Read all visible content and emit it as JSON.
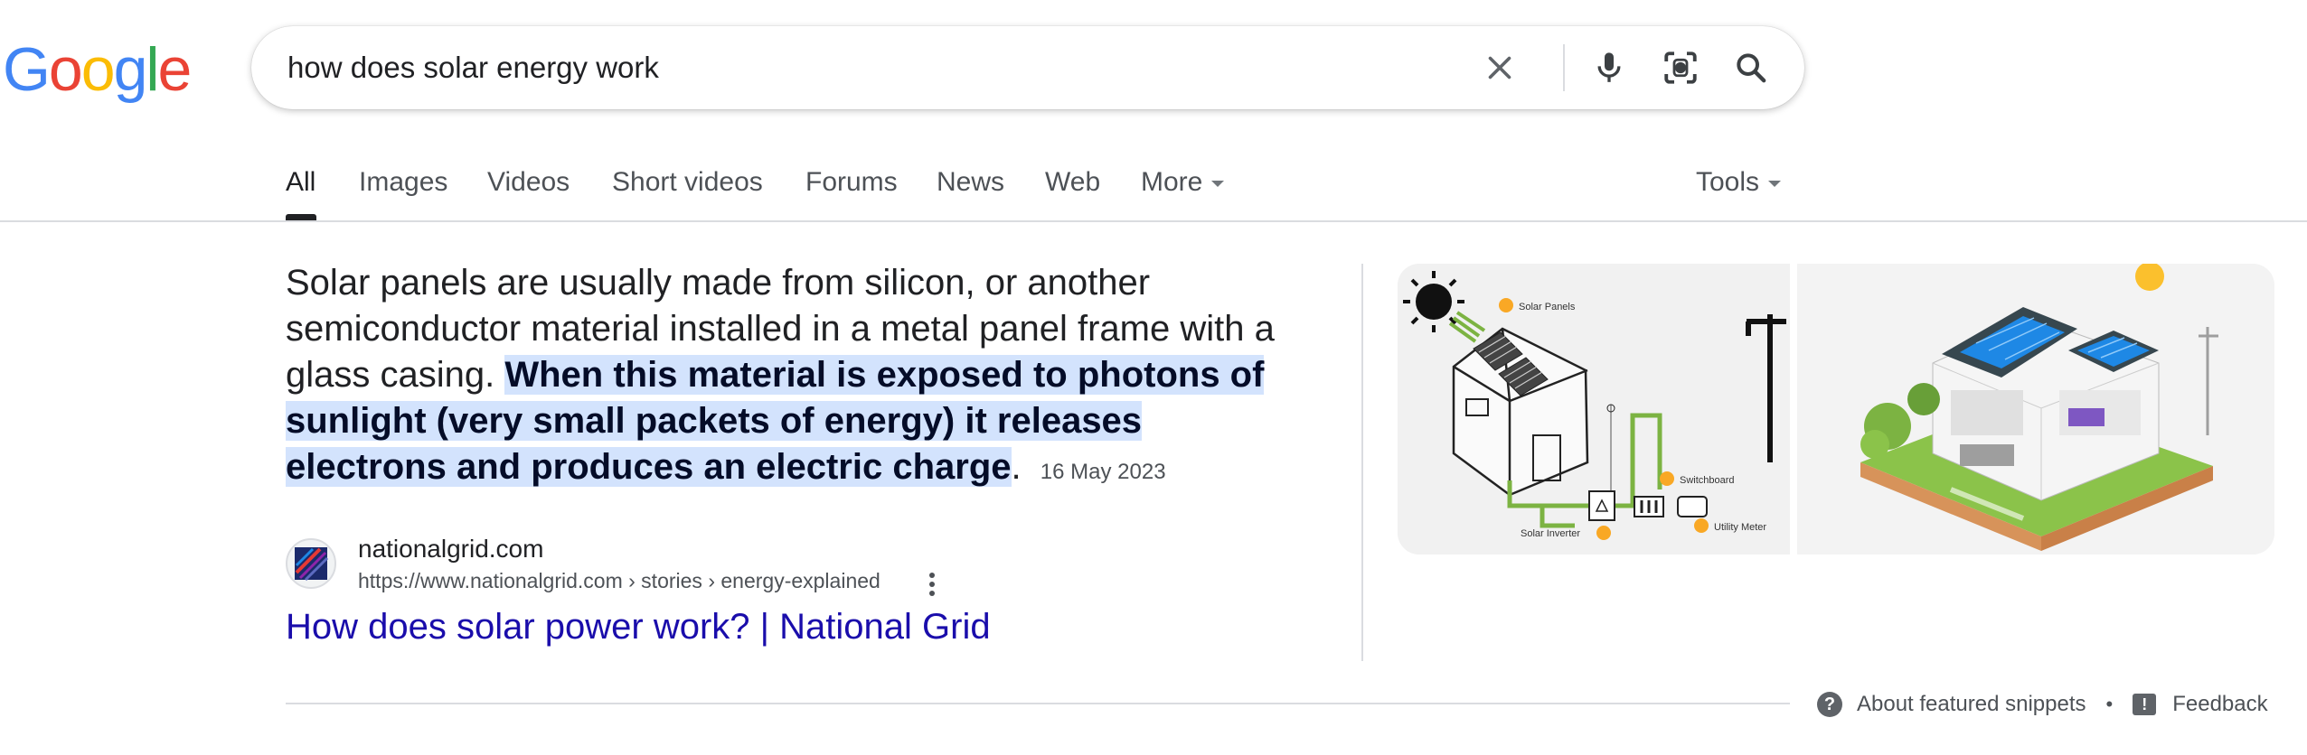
{
  "logo": {
    "letters": [
      "G",
      "o",
      "o",
      "g",
      "l",
      "e"
    ],
    "colors": [
      "#4285F4",
      "#EA4335",
      "#FBBC05",
      "#4285F4",
      "#34A853",
      "#EA4335"
    ]
  },
  "search": {
    "query": "how does solar energy work"
  },
  "icons": {
    "clear": "close-icon",
    "voice": "microphone-icon",
    "lens": "camera-lens-icon",
    "search": "search-icon"
  },
  "tabs": [
    {
      "label": "All",
      "active": true
    },
    {
      "label": "Images"
    },
    {
      "label": "Videos"
    },
    {
      "label": "Short videos"
    },
    {
      "label": "Forums"
    },
    {
      "label": "News"
    },
    {
      "label": "Web"
    },
    {
      "label": "More"
    }
  ],
  "tools_label": "Tools",
  "snippet": {
    "text_plain": "Solar panels are usually made from silicon, or another semiconductor material installed in a metal panel frame with a glass casing.",
    "text_highlight": "When this material is exposed to photons of sunlight (very small packets of energy) it releases electrons and produces an electric charge",
    "text_end": ".",
    "date": "16 May 2023"
  },
  "source": {
    "site_name": "nationalgrid.com",
    "url": "https://www.nationalgrid.com › stories › energy-explained"
  },
  "result_title": "How does solar power work? | National Grid",
  "diagram_labels": {
    "solar_panels": "Solar Panels",
    "switchboard": "Switchboard",
    "solar_inverter": "Solar Inverter",
    "utility_meter": "Utility Meter"
  },
  "footer": {
    "about": "About featured snippets",
    "separator": "•",
    "feedback": "Feedback"
  },
  "colors": {
    "link": "#1a0dab",
    "highlight": "#d3e3fd",
    "grid_line": "#7cb342"
  }
}
